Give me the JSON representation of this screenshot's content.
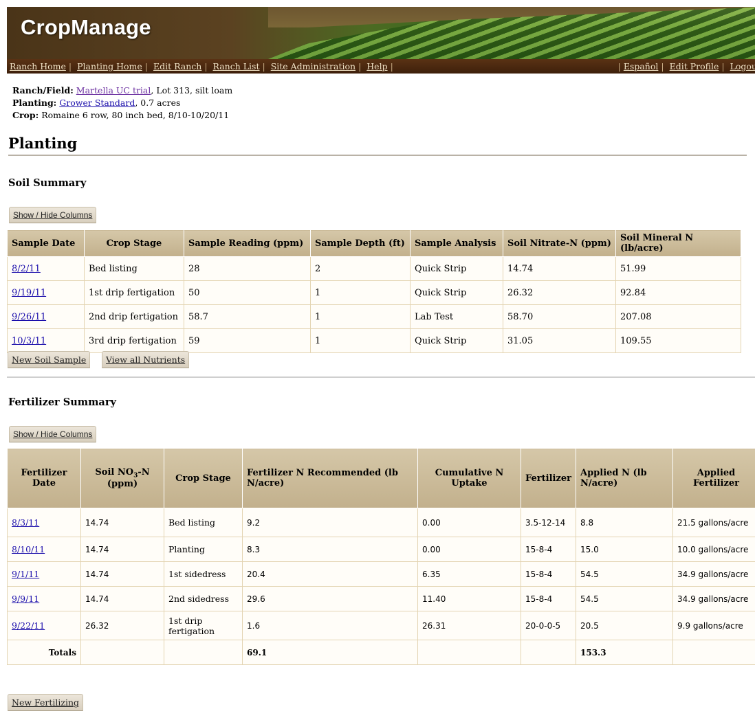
{
  "app": {
    "brand": "CropManage"
  },
  "nav": {
    "left": [
      "Ranch Home",
      "Planting Home",
      "Edit Ranch",
      "Ranch List",
      "Site Administration",
      "Help"
    ],
    "right": [
      "Español",
      "Edit Profile",
      "Logout"
    ]
  },
  "info": {
    "ranch_label": "Ranch/Field:",
    "ranch_link": "Martella UC trial",
    "ranch_rest": ", Lot 313, silt loam",
    "planting_label": "Planting:",
    "planting_link": "Grower Standard",
    "planting_rest": ", 0.7 acres",
    "crop_label": "Crop:",
    "crop_rest": " Romaine 6 row, 80 inch bed, 8/10-10/20/11"
  },
  "page_title": "Planting",
  "soil": {
    "title": "Soil Summary",
    "show_hide": "Show / Hide Columns",
    "headers": [
      "Sample Date",
      "Crop Stage",
      "Sample Reading (ppm)",
      "Sample Depth (ft)",
      "Sample Analysis",
      "Soil Nitrate-N (ppm)",
      "Soil Mineral N (lb/acre)"
    ],
    "rows": [
      [
        "8/2/11",
        "Bed listing",
        "28",
        "2",
        "Quick Strip",
        "14.74",
        "51.99"
      ],
      [
        "9/19/11",
        "1st drip fertigation",
        "50",
        "1",
        "Quick Strip",
        "26.32",
        "92.84"
      ],
      [
        "9/26/11",
        "2nd drip fertigation",
        "58.7",
        "1",
        "Lab Test",
        "58.70",
        "207.08"
      ],
      [
        "10/3/11",
        "3rd drip fertigation",
        "59",
        "1",
        "Quick Strip",
        "31.05",
        "109.55"
      ]
    ],
    "new_button": "New Soil Sample",
    "view_button": "View all Nutrients"
  },
  "fert": {
    "title": "Fertilizer Summary",
    "show_hide": "Show / Hide Columns",
    "headers": [
      "Fertilizer Date",
      "Soil NO3-N (ppm)",
      "Crop Stage",
      "Fertilizer N Recommended (lb N/acre)",
      "Cumulative N Uptake",
      "Fertilizer",
      "Applied N (lb N/acre)",
      "Applied Fertilizer"
    ],
    "rows": [
      [
        "8/3/11",
        "14.74",
        "Bed listing",
        "9.2",
        "0.00",
        "3.5-12-14",
        "8.8",
        "21.5 gallons/acre"
      ],
      [
        "8/10/11",
        "14.74",
        "Planting",
        "8.3",
        "0.00",
        "15-8-4",
        "15.0",
        "10.0 gallons/acre"
      ],
      [
        "9/1/11",
        "14.74",
        "1st sidedress",
        "20.4",
        "6.35",
        "15-8-4",
        "54.5",
        "34.9 gallons/acre"
      ],
      [
        "9/9/11",
        "14.74",
        "2nd sidedress",
        "29.6",
        "11.40",
        "15-8-4",
        "54.5",
        "34.9 gallons/acre"
      ],
      [
        "9/22/11",
        "26.32",
        "1st drip fertigation",
        "1.6",
        "26.31",
        "20-0-0-5",
        "20.5",
        "9.9 gallons/acre"
      ]
    ],
    "totals": {
      "label": "Totals",
      "recommended": "69.1",
      "applied": "153.3"
    },
    "new_button": "New Fertilizing"
  }
}
